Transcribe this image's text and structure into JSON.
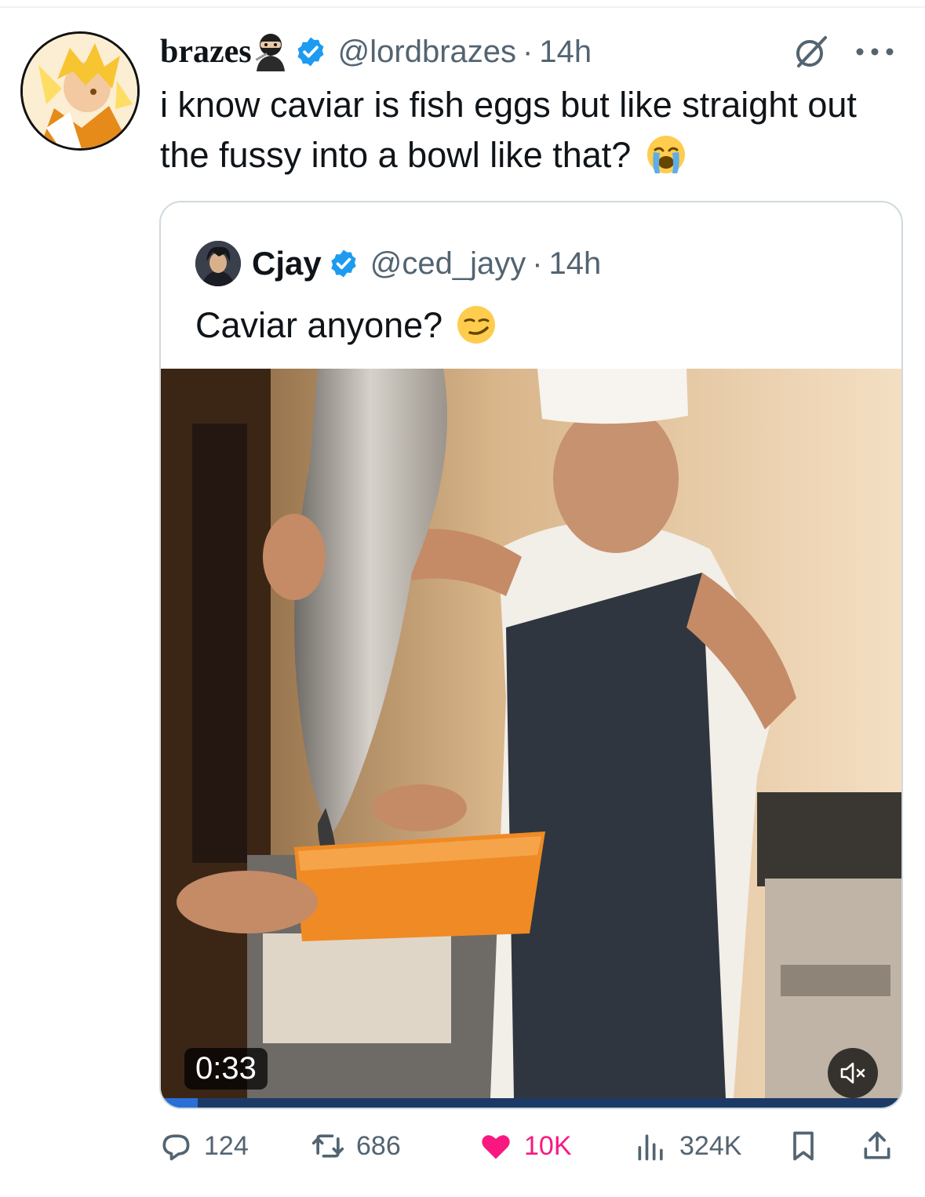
{
  "tweet": {
    "display_name": "brazes",
    "handle": "@lordbrazes",
    "separator": "·",
    "time": "14h",
    "text": "i know caviar is fish eggs but like straight out the fussy into a bowl like that?"
  },
  "quoted_tweet": {
    "display_name": "Cjay",
    "handle": "@ced_jayy",
    "separator": "·",
    "time": "14h",
    "text": "Caviar anyone?",
    "video": {
      "duration": "0:33",
      "progress": 0.05
    }
  },
  "actions": {
    "replies": "124",
    "reposts": "686",
    "likes": "10K",
    "views": "324K"
  },
  "colors": {
    "verified": "#1d9bf0",
    "like": "#f91880",
    "muted_text": "#536471",
    "border": "#cfd9de"
  },
  "icons": [
    "ninja-emoji-icon",
    "verified-badge-icon",
    "grok-icon",
    "more-icon",
    "loudly-crying-emoji-icon",
    "smirk-emoji-icon",
    "mute-icon",
    "reply-icon",
    "repost-icon",
    "like-icon",
    "views-icon",
    "bookmark-icon",
    "share-icon"
  ]
}
